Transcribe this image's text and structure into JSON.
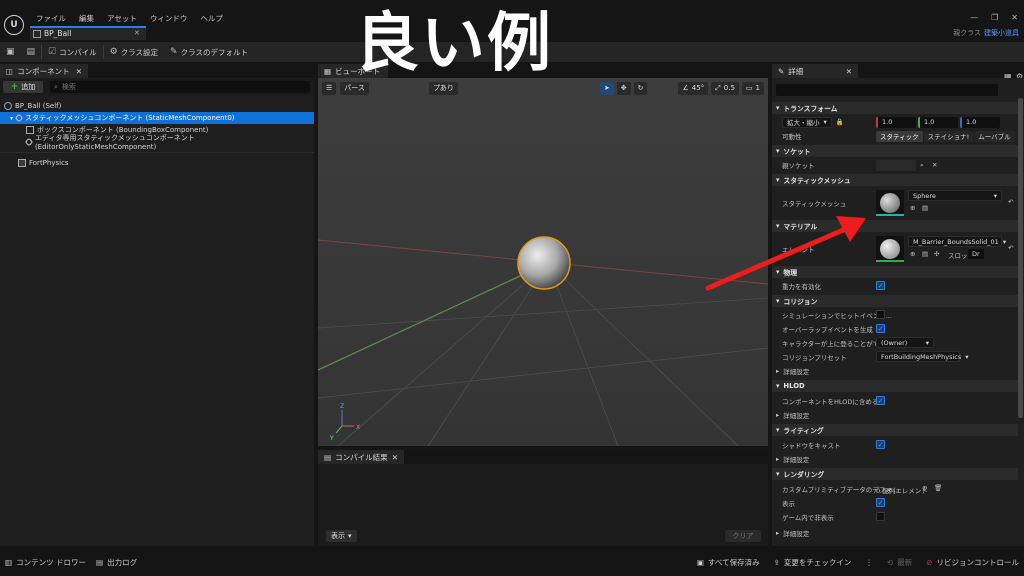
{
  "window": {
    "tab_title": "BP_Ball",
    "close_glyph": "✕",
    "logo_glyph": "U",
    "parent_class_label": "親クラス",
    "parent_class_value": "建築小道具",
    "controls": [
      "—",
      "❐",
      "✕"
    ]
  },
  "menu": [
    "ファイル",
    "編集",
    "アセット",
    "ウィンドウ",
    "ヘルプ"
  ],
  "toolbar": {
    "compile": "コンパイル",
    "class_settings": "クラス設定",
    "class_defaults": "クラスのデフォルト"
  },
  "components": {
    "tab_label": "コンポーネント",
    "add_label": "追加",
    "search_placeholder": "検索",
    "items": [
      {
        "label": "BP_Ball (Self)",
        "indent": 0
      },
      {
        "label": "スタティックメッシュコンポーネント (StaticMeshComponent0)",
        "indent": 1,
        "selected": true
      },
      {
        "label": "ボックスコンポーネント (BoundingBoxComponent)",
        "indent": 2
      },
      {
        "label": "エディタ専用スタティックメッシュコンポーネント (EditorOnlyStaticMeshComponent)",
        "indent": 2
      }
    ],
    "extra_item": "FortPhysics"
  },
  "viewport": {
    "tab_label": "ビューポート",
    "perspective": "パース",
    "lit": "プあり",
    "angle": "45°",
    "speed": "0.5",
    "cam": "1",
    "axes": {
      "z": "Z",
      "x": "X",
      "y": "Y"
    }
  },
  "overlay_title": "良い例",
  "compile_results": {
    "tab_label": "コンパイル結果",
    "show": "表示",
    "clear": "クリア"
  },
  "details": {
    "tab_label": "詳細",
    "sections": {
      "transform": "トランスフォーム",
      "socket": "ソケット",
      "static_mesh": "スタティックメッシュ",
      "material": "マテリアル",
      "physics": "物理",
      "collision": "コリジョン",
      "hlod": "HLOD",
      "lighting": "ライティング",
      "rendering": "レンダリング"
    },
    "scale_label": "拡大・縮小",
    "scale_values": [
      "1.0",
      "1.0",
      "1.0"
    ],
    "mobility_label": "可動性",
    "mobility_options": [
      "スタティック",
      "ステイショナ!",
      "ムーバブル"
    ],
    "parent_socket_label": "親ソケット",
    "static_mesh_label": "スタティックメッシュ",
    "static_mesh_value": "Sphere",
    "element_label": "エレメント",
    "material_value": "M_Barrier_BoundsSolid_01",
    "slot_label": "スロット",
    "slot_value": "Dr",
    "gravity_label": "重力を有効化",
    "sim_hit_label": "シミュレーションでヒットイベント...",
    "overlap_label": "オーバーラップイベントを生成",
    "step_up_label": "キャラクターが上に登ることができ...",
    "step_up_value": "(Owner)",
    "preset_label": "コリジョンプリセット",
    "preset_value": "FortBuildingMeshPhysics",
    "advanced": "詳細設定",
    "hlod_include_label": "コンポーネントをHLODに含める",
    "cast_shadow_label": "シャドウをキャスト",
    "custom_prim_label": "カスタムプリミティブデータのデフォ...",
    "custom_prim_value": "0 配列エレメント",
    "visible_label": "表示",
    "hidden_in_game_label": "ゲーム内で非表示"
  },
  "status": {
    "content_drawer": "コンテンツ ドロワー",
    "output_log": "出力ログ",
    "save_all": "すべて保存済み",
    "check_in": "変更をチェックイン",
    "latest": "最新",
    "revision_control": "リビジョンコントロール"
  }
}
